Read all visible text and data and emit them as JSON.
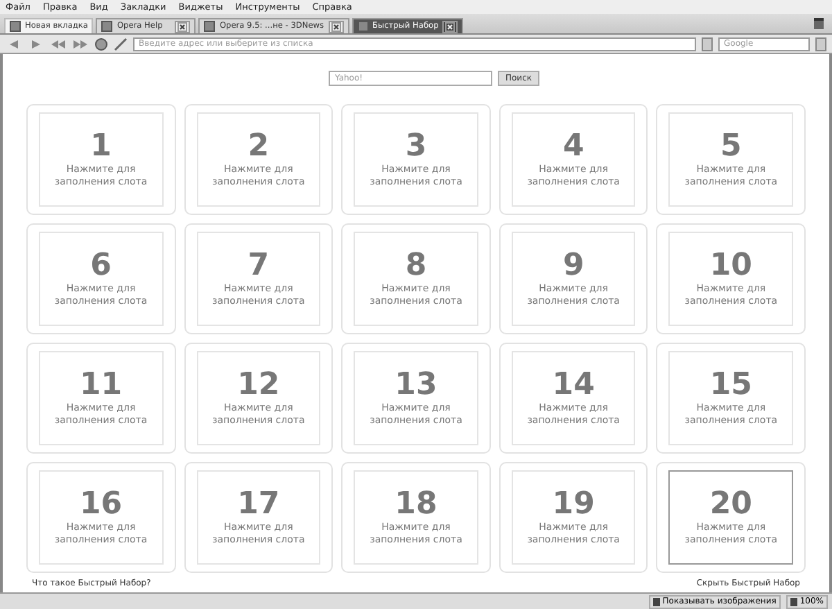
{
  "menu": [
    "Файл",
    "Правка",
    "Вид",
    "Закладки",
    "Виджеты",
    "Инструменты",
    "Справка"
  ],
  "tabs": [
    {
      "kind": "new",
      "label": "Новая вкладка",
      "selected": false
    },
    {
      "kind": "page",
      "label": "Opera Help",
      "selected": false
    },
    {
      "kind": "page",
      "label": "Opera 9.5: ...не - 3DNews",
      "selected": false
    },
    {
      "kind": "page",
      "label": "Быстрый Набор",
      "selected": true
    }
  ],
  "toolbar": {
    "address_placeholder": "Введите адрес или выберите из списка",
    "search_placeholder": "Google"
  },
  "speed_dial": {
    "search": {
      "placeholder": "Yahoo!",
      "button": "Поиск"
    },
    "slots": [
      {
        "number": "1",
        "caption": "Нажмите для заполнения слота",
        "selected": false
      },
      {
        "number": "2",
        "caption": "Нажмите для заполнения слота",
        "selected": false
      },
      {
        "number": "3",
        "caption": "Нажмите для заполнения слота",
        "selected": false
      },
      {
        "number": "4",
        "caption": "Нажмите для заполнения слота",
        "selected": false
      },
      {
        "number": "5",
        "caption": "Нажмите для заполнения слота",
        "selected": false
      },
      {
        "number": "6",
        "caption": "Нажмите для заполнения слота",
        "selected": false
      },
      {
        "number": "7",
        "caption": "Нажмите для заполнения слота",
        "selected": false
      },
      {
        "number": "8",
        "caption": "Нажмите для заполнения слота",
        "selected": false
      },
      {
        "number": "9",
        "caption": "Нажмите для заполнения слота",
        "selected": false
      },
      {
        "number": "10",
        "caption": "Нажмите для заполнения слота",
        "selected": false
      },
      {
        "number": "11",
        "caption": "Нажмите для заполнения слота",
        "selected": false
      },
      {
        "number": "12",
        "caption": "Нажмите для заполнения слота",
        "selected": false
      },
      {
        "number": "13",
        "caption": "Нажмите для заполнения слота",
        "selected": false
      },
      {
        "number": "14",
        "caption": "Нажмите для заполнения слота",
        "selected": false
      },
      {
        "number": "15",
        "caption": "Нажмите для заполнения слота",
        "selected": false
      },
      {
        "number": "16",
        "caption": "Нажмите для заполнения слота",
        "selected": false
      },
      {
        "number": "17",
        "caption": "Нажмите для заполнения слота",
        "selected": false
      },
      {
        "number": "18",
        "caption": "Нажмите для заполнения слота",
        "selected": false
      },
      {
        "number": "19",
        "caption": "Нажмите для заполнения слота",
        "selected": false
      },
      {
        "number": "20",
        "caption": "Нажмите для заполнения слота",
        "selected": true
      }
    ],
    "help_link": "Что такое Быстрый Набор?",
    "hide_link": "Скрыть Быстрый Набор"
  },
  "status_bar": {
    "images": "Показывать изображения",
    "zoom": "100%"
  }
}
